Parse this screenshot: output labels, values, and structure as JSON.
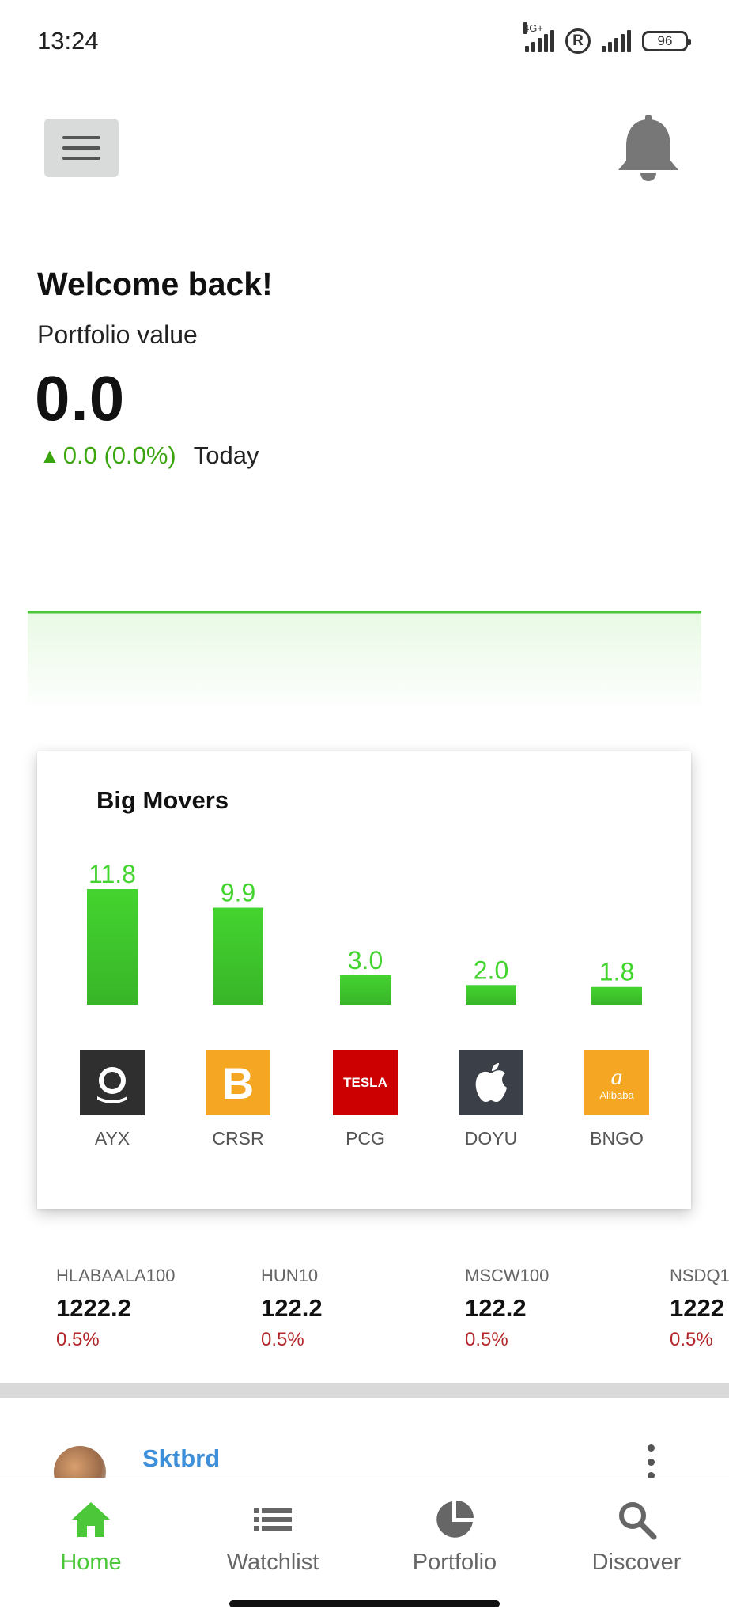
{
  "status_bar": {
    "time": "13:24",
    "network_label": "4G+",
    "roaming_indicator": "R",
    "battery_level": "96"
  },
  "header": {
    "menu_icon": "hamburger-menu-icon",
    "notification_icon": "bell-icon"
  },
  "welcome": {
    "title": "Welcome back!",
    "portfolio_label": "Portfolio value",
    "portfolio_value": "0.0",
    "change_arrow": "▲",
    "change_value": "0.0 (0.0%)",
    "change_period": "Today"
  },
  "colors": {
    "positive": "#3aa50f",
    "negative": "#b3262a",
    "bar_green": "#44d42f",
    "link_blue": "#3c8fd8",
    "nav_active": "#4cc73a"
  },
  "big_movers": {
    "title": "Big Movers",
    "chart_data": {
      "type": "bar",
      "categories": [
        "AYX",
        "CRSR",
        "PCG",
        "DOYU",
        "BNGO"
      ],
      "values": [
        11.8,
        9.9,
        3.0,
        2.0,
        1.8
      ],
      "value_labels": [
        "11.8",
        "9.9",
        "3.0",
        "2.0",
        "1.8"
      ],
      "ylim": [
        0,
        11.8
      ]
    },
    "logos": [
      {
        "ticker": "AYX",
        "icon": "ring-logo-icon",
        "bg": "#2f2f2f"
      },
      {
        "ticker": "CRSR",
        "icon": "bitcoin-logo-icon",
        "bg": "#f5a623"
      },
      {
        "ticker": "PCG",
        "icon": "tesla-logo-icon",
        "bg": "#cc0000",
        "text": "TESLA"
      },
      {
        "ticker": "DOYU",
        "icon": "apple-logo-icon",
        "bg": "#3b3f48"
      },
      {
        "ticker": "BNGO",
        "icon": "alibaba-logo-icon",
        "bg": "#f5a623",
        "text": "Alibaba"
      }
    ]
  },
  "indices": [
    {
      "name": "HLABAALA100",
      "value": "1222.2",
      "change": "0.5%"
    },
    {
      "name": "HUN10",
      "value": "122.2",
      "change": "0.5%"
    },
    {
      "name": "MSCW100",
      "value": "122.2",
      "change": "0.5%"
    },
    {
      "name": "NSDQ1",
      "value": "1222",
      "change": "0.5%"
    }
  ],
  "feed": {
    "username": "Sktbrd",
    "more_icon": "more-vertical-icon"
  },
  "nav": {
    "items": [
      {
        "label": "Home",
        "icon": "home-icon",
        "active": true
      },
      {
        "label": "Watchlist",
        "icon": "list-icon",
        "active": false
      },
      {
        "label": "Portfolio",
        "icon": "pie-chart-icon",
        "active": false
      },
      {
        "label": "Discover",
        "icon": "search-icon",
        "active": false
      }
    ]
  }
}
